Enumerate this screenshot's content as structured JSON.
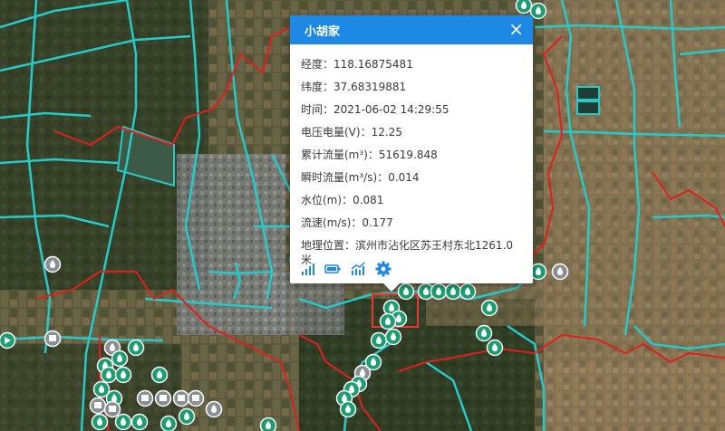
{
  "popup": {
    "title": "小胡家",
    "close_glyph": "×",
    "fields": [
      {
        "label": "经度",
        "sep": "：",
        "value": "118.16875481"
      },
      {
        "label": "纬度",
        "sep": "：",
        "value": "37.68319881"
      },
      {
        "label": "时间",
        "sep": "：",
        "value": "2021-06-02 14:29:55"
      },
      {
        "label": "电压电量(V)",
        "sep": "：",
        "value": "12.25"
      },
      {
        "label": "累计流量(m³)",
        "sep": "：",
        "value": "51619.848"
      },
      {
        "label": "瞬时流量(m³/s)",
        "sep": "：",
        "value": "0.014"
      },
      {
        "label": "水位(m)",
        "sep": "：",
        "value": "0.081"
      },
      {
        "label": "流速(m/s)",
        "sep": "：",
        "value": "0.177"
      },
      {
        "label": "地理位置",
        "sep": "：",
        "value": "滨州市沾化区苏王村东北1261.0米"
      }
    ],
    "actions": [
      {
        "name": "signal-icon"
      },
      {
        "name": "battery-icon"
      },
      {
        "name": "trend-chart-icon"
      },
      {
        "name": "gear-icon"
      }
    ]
  },
  "colors": {
    "boundary_red": "#e0201c",
    "channel_cyan": "#27c9c9",
    "station_green": "#1a9e70",
    "station_gray": "#8a8f96",
    "selection_red": "#e53935",
    "popup_header": "#1e88e5",
    "action_blue": "#1e88e5"
  },
  "map": {
    "type": "satellite",
    "markers": [
      "water-drop-station",
      "gauge-station",
      "camera-station"
    ]
  }
}
